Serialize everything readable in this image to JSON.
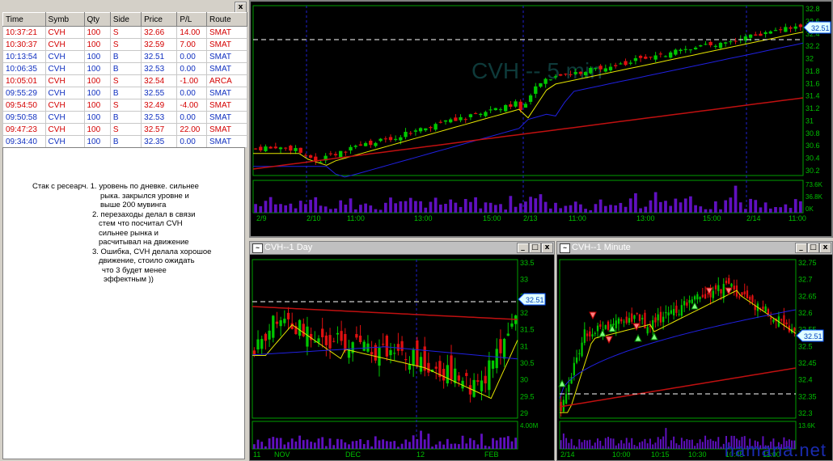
{
  "blotter": {
    "close_label": "x",
    "columns": [
      "Time",
      "Symb",
      "Qty",
      "Side",
      "Price",
      "P/L",
      "Route"
    ],
    "rows": [
      {
        "time": "10:37:21",
        "symb": "CVH",
        "qty": "100",
        "side": "S",
        "price": "32.66",
        "pl": "14.00",
        "route": "SMAT"
      },
      {
        "time": "10:30:37",
        "symb": "CVH",
        "qty": "100",
        "side": "S",
        "price": "32.59",
        "pl": "7.00",
        "route": "SMAT"
      },
      {
        "time": "10:13:54",
        "symb": "CVH",
        "qty": "100",
        "side": "B",
        "price": "32.51",
        "pl": "0.00",
        "route": "SMAT"
      },
      {
        "time": "10:06:35",
        "symb": "CVH",
        "qty": "100",
        "side": "B",
        "price": "32.53",
        "pl": "0.00",
        "route": "SMAT"
      },
      {
        "time": "10:05:01",
        "symb": "CVH",
        "qty": "100",
        "side": "S",
        "price": "32.54",
        "pl": "-1.00",
        "route": "ARCA"
      },
      {
        "time": "09:55:29",
        "symb": "CVH",
        "qty": "100",
        "side": "B",
        "price": "32.55",
        "pl": "0.00",
        "route": "SMAT"
      },
      {
        "time": "09:54:50",
        "symb": "CVH",
        "qty": "100",
        "side": "S",
        "price": "32.49",
        "pl": "-4.00",
        "route": "SMAT"
      },
      {
        "time": "09:50:58",
        "symb": "CVH",
        "qty": "100",
        "side": "B",
        "price": "32.53",
        "pl": "0.00",
        "route": "SMAT"
      },
      {
        "time": "09:47:23",
        "symb": "CVH",
        "qty": "100",
        "side": "S",
        "price": "32.57",
        "pl": "22.00",
        "route": "SMAT"
      },
      {
        "time": "09:34:40",
        "symb": "CVH",
        "qty": "100",
        "side": "B",
        "price": "32.35",
        "pl": "0.00",
        "route": "SMAT"
      }
    ]
  },
  "notes": {
    "lines": [
      "Стак с ресеарч. 1. уровень по дневке. сильнее",
      "рыка. закрылся уровне и",
      "выше 200 мувинга",
      "2. перезаходы делал в связи",
      "стем что посчитал CVH",
      "сильнее рынка  и",
      "расчитывал на движение",
      "3. Ошибка, CVH делала хорошое",
      "движение, стоило ожидать",
      "что 3 будет менее",
      "эффектным ))"
    ]
  },
  "chart_5min": {
    "watermark": "CVH -- 5 min",
    "price_ticks": [
      "32.8",
      "32.6",
      "32.4",
      "32.2",
      "32",
      "31.8",
      "31.6",
      "31.4",
      "31.2",
      "31",
      "30.8",
      "30.6",
      "30.4",
      "30.2"
    ],
    "volume_ticks": [
      "73.6K",
      "36.8K",
      "0K"
    ],
    "time_labels": [
      "2/9",
      "2/10",
      "11:00",
      "13:00",
      "15:00",
      "2/13",
      "11:00",
      "13:00",
      "15:00",
      "2/14",
      "11:00"
    ],
    "last_price": "32.51"
  },
  "chart_day": {
    "title": "CVH--1 Day",
    "price_ticks": [
      "33.5",
      "33",
      "32.5",
      "32",
      "31.5",
      "31",
      "30.5",
      "30",
      "29.5",
      "29"
    ],
    "volume_ticks": [
      "4.00M"
    ],
    "time_labels": [
      "11",
      "NOV",
      "DEC",
      "12",
      "FEB"
    ],
    "last_price": "32.51"
  },
  "chart_min": {
    "title": "CVH--1 Minute",
    "price_ticks": [
      "32.75",
      "32.7",
      "32.65",
      "32.6",
      "32.55",
      "32.5",
      "32.45",
      "32.4",
      "32.35",
      "32.3"
    ],
    "volume_ticks": [
      "13.6K"
    ],
    "time_labels": [
      "2/14",
      "10:00",
      "10:15",
      "10:30",
      "10:45",
      "11:00"
    ],
    "last_price": "32.51"
  },
  "window_buttons": {
    "minimize": "_",
    "maximize": "□",
    "close": "x"
  },
  "watermark": "hamana.net",
  "colors": {
    "up": "#00c800",
    "down": "#e01010",
    "ema_fast": "#e6e600",
    "ema_mid": "#2020e0",
    "ema_slow": "#c01010",
    "volume": "#6010c0"
  }
}
